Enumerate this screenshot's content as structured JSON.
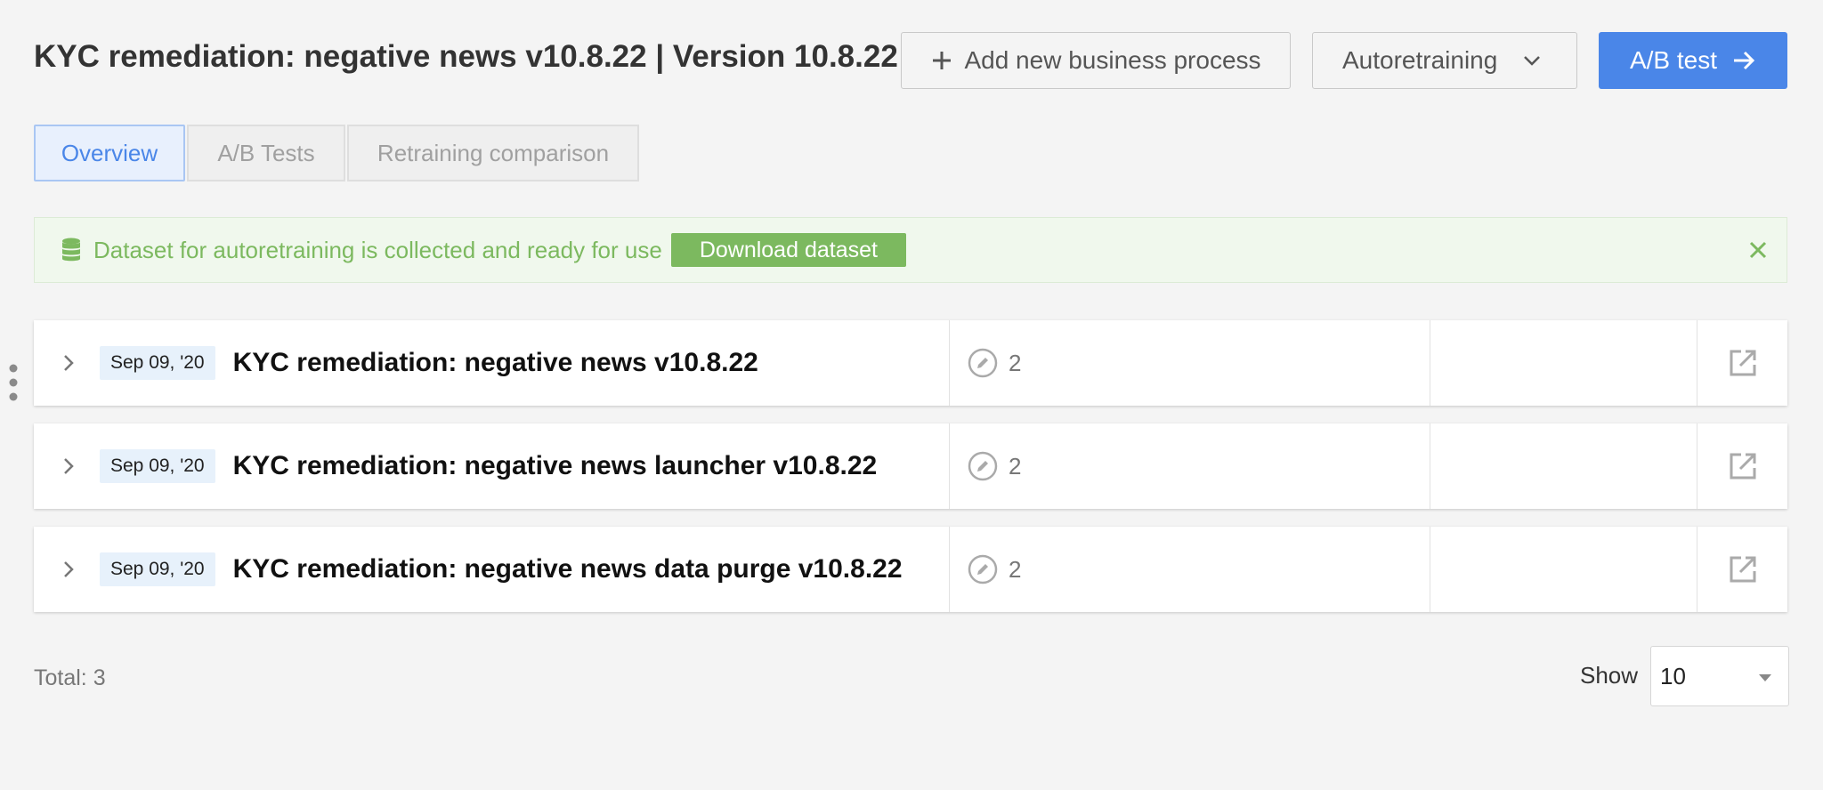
{
  "header": {
    "title": "KYC remediation: negative news v10.8.22 | Version 10.8.22",
    "add_process_label": "Add new business process",
    "autoretraining_label": "Autoretraining",
    "ab_test_label": "A/B test"
  },
  "tabs": [
    {
      "label": "Overview",
      "active": true
    },
    {
      "label": "A/B Tests",
      "active": false
    },
    {
      "label": "Retraining comparison",
      "active": false
    }
  ],
  "alert": {
    "message": "Dataset for autoretraining is collected and ready for use",
    "download_label": "Download dataset",
    "icon": "database-icon"
  },
  "rows": [
    {
      "date": "Sep 09, '20",
      "name": "KYC remediation: negative news v10.8.22",
      "count": "2"
    },
    {
      "date": "Sep 09, '20",
      "name": "KYC remediation: negative news launcher v10.8.22",
      "count": "2"
    },
    {
      "date": "Sep 09, '20",
      "name": "KYC remediation: negative news data purge v10.8.22",
      "count": "2"
    }
  ],
  "footer": {
    "total": "Total: 3",
    "show_label": "Show",
    "page_size": "10"
  },
  "colors": {
    "primary": "#4a86e8",
    "success": "#7cb95f",
    "background": "#f4f4f4"
  }
}
